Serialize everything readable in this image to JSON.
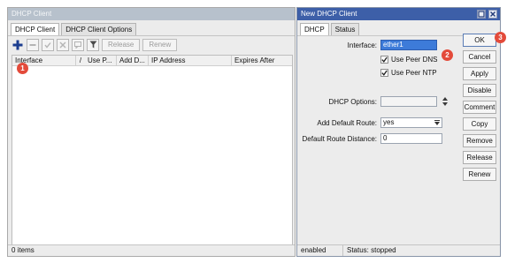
{
  "left_window": {
    "title": "DHCP Client",
    "tabs": [
      {
        "label": "DHCP Client",
        "active": true
      },
      {
        "label": "DHCP Client Options",
        "active": false
      }
    ],
    "toolbar": {
      "icons": [
        "add-icon",
        "remove-icon",
        "enable-icon",
        "disable-icon",
        "comment-icon",
        "filter-icon"
      ],
      "release_label": "Release",
      "renew_label": "Renew"
    },
    "table": {
      "columns": [
        "Interface",
        "/",
        "Use P...",
        "Add D...",
        "IP Address",
        "Expires After"
      ]
    },
    "status": "0 items"
  },
  "right_window": {
    "title": "New DHCP Client",
    "tabs": [
      {
        "label": "DHCP",
        "active": true
      },
      {
        "label": "Status",
        "active": false
      }
    ],
    "form": {
      "interface_label": "Interface:",
      "interface_value": "ether1",
      "use_peer_dns_label": "Use Peer DNS",
      "use_peer_dns_checked": true,
      "use_peer_ntp_label": "Use Peer NTP",
      "use_peer_ntp_checked": true,
      "dhcp_options_label": "DHCP Options:",
      "dhcp_options_value": "",
      "add_default_route_label": "Add Default Route:",
      "add_default_route_value": "yes",
      "default_route_distance_label": "Default Route Distance:",
      "default_route_distance_value": "0"
    },
    "buttons": [
      "OK",
      "Cancel",
      "Apply",
      "Disable",
      "Comment",
      "Copy",
      "Remove",
      "Release",
      "Renew"
    ],
    "status_left": "enabled",
    "status_right": "Status: stopped"
  },
  "callouts": [
    "1",
    "2",
    "3"
  ],
  "colors": {
    "accent_title": "#3d5fa8",
    "inactive_title": "#b7c1cc",
    "callout": "#e34a3a",
    "selection": "#3d7bd9"
  }
}
